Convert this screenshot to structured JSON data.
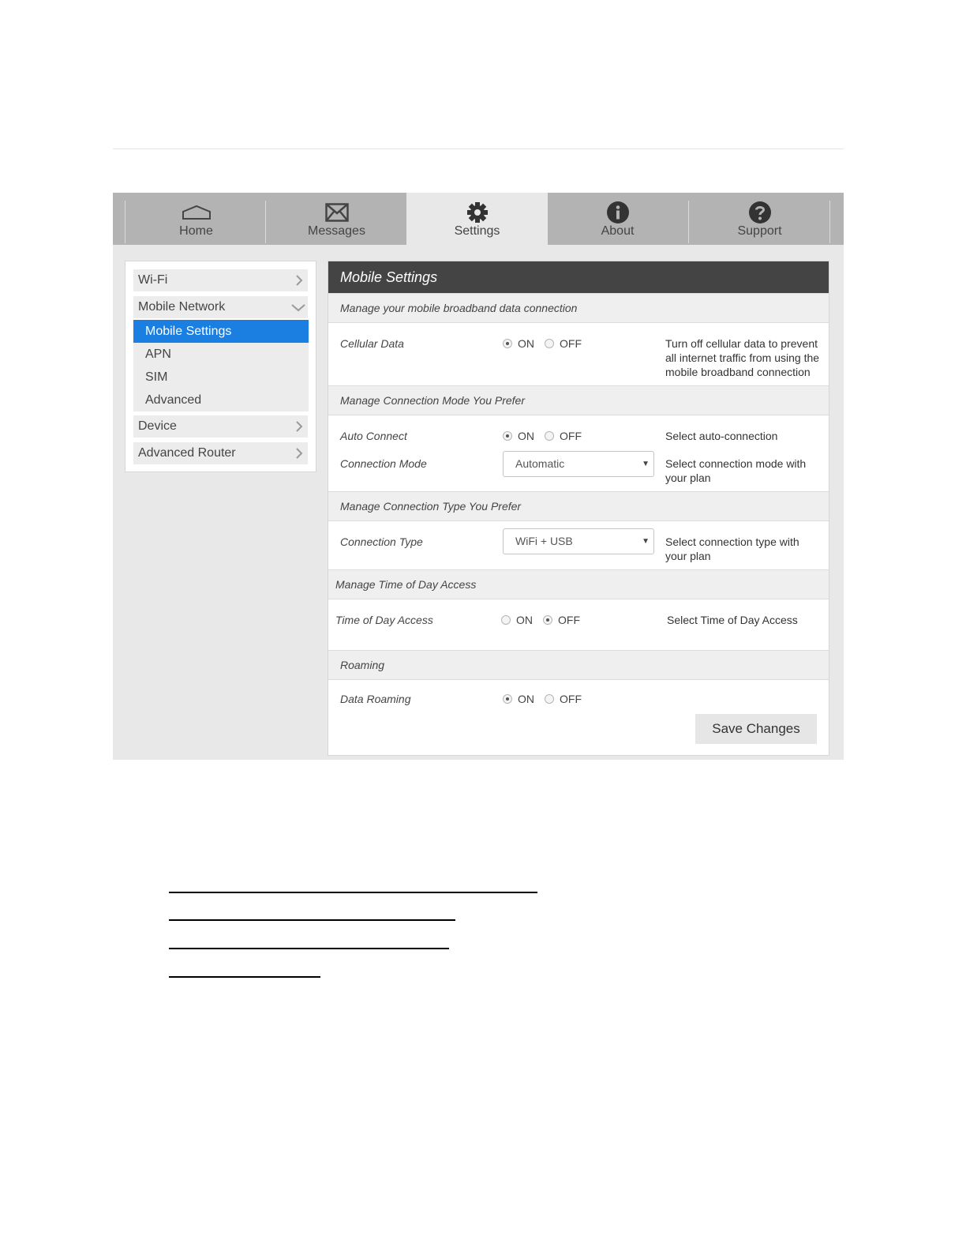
{
  "nav": {
    "tabs": [
      {
        "label": "Home",
        "icon": "home-icon"
      },
      {
        "label": "Messages",
        "icon": "envelope-icon"
      },
      {
        "label": "Settings",
        "icon": "gear-icon",
        "active": true
      },
      {
        "label": "About",
        "icon": "info-icon"
      },
      {
        "label": "Support",
        "icon": "question-icon"
      }
    ]
  },
  "sidebar": {
    "wifi": "Wi-Fi",
    "mobile_network": "Mobile Network",
    "sub_items": [
      "Mobile Settings",
      "APN",
      "SIM",
      "Advanced"
    ],
    "active_sub": "Mobile Settings",
    "device": "Device",
    "advanced_router": "Advanced Router"
  },
  "panel": {
    "title": "Mobile Settings",
    "sections": {
      "data": "Manage your mobile broadband data connection",
      "mode": "Manage Connection Mode You Prefer",
      "type": "Manage Connection Type You Prefer",
      "tod": "Manage Time of Day Access",
      "roaming": "Roaming"
    },
    "on_label": "ON",
    "off_label": "OFF",
    "cellular_data": {
      "label": "Cellular Data",
      "value": "ON",
      "desc": "Turn off cellular data to prevent all internet traffic from using the mobile broadband connection"
    },
    "auto_connect": {
      "label": "Auto Connect",
      "value": "ON",
      "desc": "Select auto-connection"
    },
    "connection_mode": {
      "label": "Connection Mode",
      "value": "Automatic",
      "desc": "Select connection mode with your plan"
    },
    "connection_type": {
      "label": "Connection Type",
      "value": "WiFi + USB",
      "desc": "Select connection type with your plan"
    },
    "time_of_day": {
      "label": "Time of Day Access",
      "value": "OFF",
      "desc": "Select Time of Day Access"
    },
    "data_roaming": {
      "label": "Data Roaming",
      "value": "ON"
    },
    "save_label": "Save Changes"
  },
  "colors": {
    "nav_bg": "#b3b3b3",
    "frame_bg": "#e8e8e8",
    "title_bar": "#444444",
    "active_item": "#1a7fe0"
  }
}
